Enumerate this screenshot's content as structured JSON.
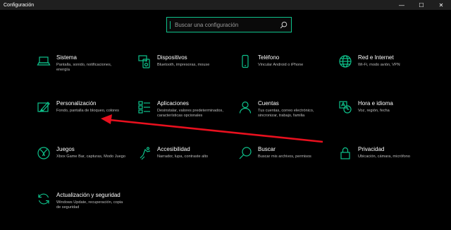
{
  "window": {
    "title": "Configuración",
    "minimize": "—",
    "maximize": "☐",
    "close": "✕"
  },
  "search": {
    "placeholder": "Buscar una configuración",
    "icon": "search-icon"
  },
  "accent_color": "#0ec28b",
  "annotation_color": "#e8101e",
  "items": [
    {
      "title": "Sistema",
      "desc": "Pantalla, sonido, notificaciones, energía",
      "icon": "laptop-icon"
    },
    {
      "title": "Dispositivos",
      "desc": "Bluetooth, impresoras, mouse",
      "icon": "devices-icon"
    },
    {
      "title": "Teléfono",
      "desc": "Vincular Android o iPhone",
      "icon": "phone-icon"
    },
    {
      "title": "Red e Internet",
      "desc": "Wi-Fi, modo avión, VPN",
      "icon": "globe-icon"
    },
    {
      "title": "Personalización",
      "desc": "Fondo, pantalla de bloqueo, colores",
      "icon": "paint-icon"
    },
    {
      "title": "Aplicaciones",
      "desc": "Desinstalar, valores predeterminados, características opcionales",
      "icon": "apps-icon"
    },
    {
      "title": "Cuentas",
      "desc": "Tus cuentas, correo electrónico, sincronizar, trabajo, familia",
      "icon": "person-icon"
    },
    {
      "title": "Hora e idioma",
      "desc": "Voz, región, fecha",
      "icon": "time-language-icon"
    },
    {
      "title": "Juegos",
      "desc": "Xbox Game Bar, capturas, Modo Juego",
      "icon": "xbox-icon"
    },
    {
      "title": "Accesibilidad",
      "desc": "Narrador, lupa, contraste alto",
      "icon": "accessibility-icon"
    },
    {
      "title": "Buscar",
      "desc": "Buscar mis archivos, permisos",
      "icon": "search-icon"
    },
    {
      "title": "Privacidad",
      "desc": "Ubicación, cámara, micrófono",
      "icon": "lock-icon"
    },
    {
      "title": "Actualización y seguridad",
      "desc": "Windows Update, recuperación, copia de seguridad",
      "icon": "update-icon"
    }
  ]
}
